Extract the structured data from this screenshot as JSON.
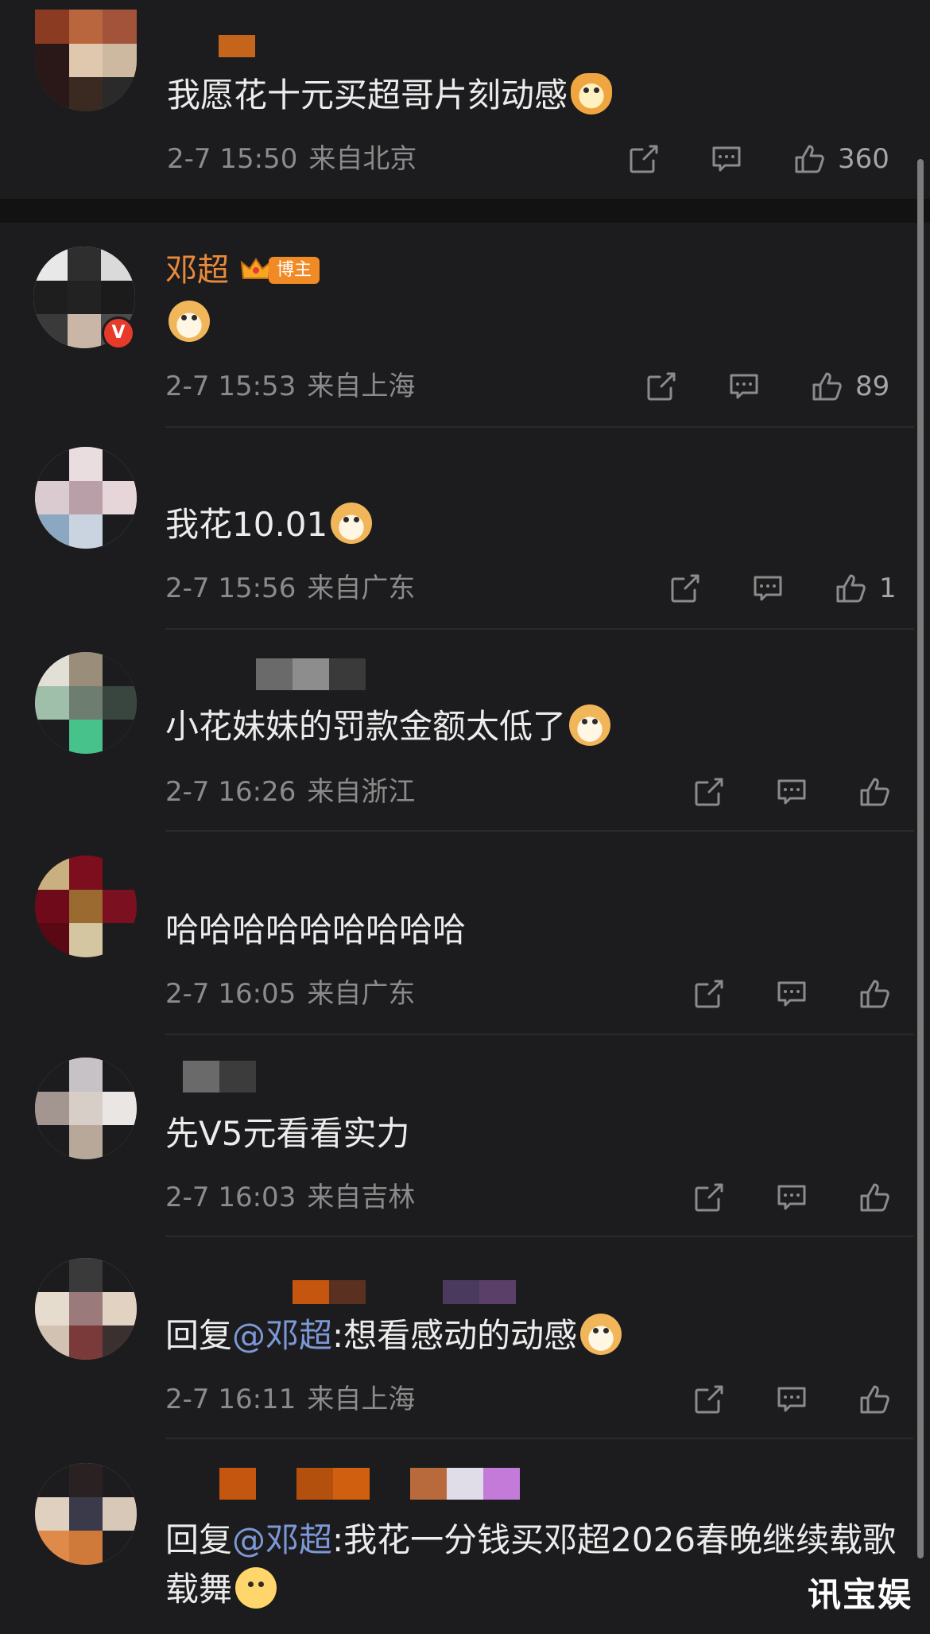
{
  "comments": [
    {
      "content": "我愿花十元买超哥片刻动感",
      "date": "2-7 15:50",
      "location": "来自北京",
      "likes": "360"
    },
    {
      "author": "邓超",
      "badge": "博主",
      "verified": "V",
      "date": "2-7 15:53",
      "location": "来自上海",
      "likes": "89"
    },
    {
      "content": "我花10.01",
      "date": "2-7 15:56",
      "location": "来自广东",
      "likes": "1"
    },
    {
      "content": "小花妹妹的罚款金额太低了",
      "date": "2-7 16:26",
      "location": "来自浙江",
      "likes": ""
    },
    {
      "content": "哈哈哈哈哈哈哈哈哈",
      "date": "2-7 16:05",
      "location": "来自广东",
      "likes": ""
    },
    {
      "content": "先V5元看看实力",
      "date": "2-7 16:03",
      "location": "来自吉林",
      "likes": ""
    },
    {
      "reply_prefix": "回复",
      "mention": "@邓超",
      "content": ":想看感动的动感",
      "date": "2-7 16:11",
      "location": "来自上海",
      "likes": ""
    },
    {
      "reply_prefix": "回复",
      "mention": "@邓超",
      "content": ":我花一分钱买邓超2026春晚继续载歌载舞"
    }
  ],
  "watermark": "讯宝娱",
  "colors": {
    "background": "#1c1c1e",
    "owner_name": "#e98a3a",
    "mention": "#7d98d6",
    "meta": "#8b8b8b"
  },
  "icons": [
    "share-icon",
    "comment-icon",
    "like-icon",
    "crown-icon",
    "doge-emoji",
    "cat-emoji",
    "tongue-emoji"
  ]
}
